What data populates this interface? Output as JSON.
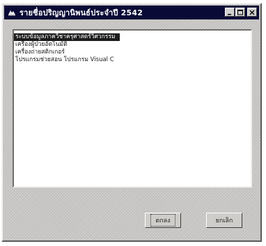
{
  "window": {
    "title": "รายชื่อปริญญานิพนธ์ประจำปี 2542",
    "icon": "app-icon"
  },
  "titlebar_buttons": {
    "minimize": "minimize-icon",
    "maximize": "maximize-icon",
    "close": "close-icon"
  },
  "list": {
    "items": [
      {
        "label": "ระบบข้อมูลภาควิชาครุศาสตร์วิศวกรรม",
        "selected": true
      },
      {
        "label": "เครื่องผู้ป่วยอัตโนมัติ",
        "selected": false
      },
      {
        "label": "เครื่องถ่ายสติกเกอร์",
        "selected": false
      },
      {
        "label": "โปรแกรมช่วยสอน โปรแกรม Visual C",
        "selected": false
      }
    ]
  },
  "buttons": {
    "ok_label": "ตกลง",
    "cancel_label": "ยกเลิก"
  },
  "colors": {
    "titlebar": "#0a0a36",
    "selection": "#1c1c1c",
    "window_face": "#c9c7c5"
  }
}
